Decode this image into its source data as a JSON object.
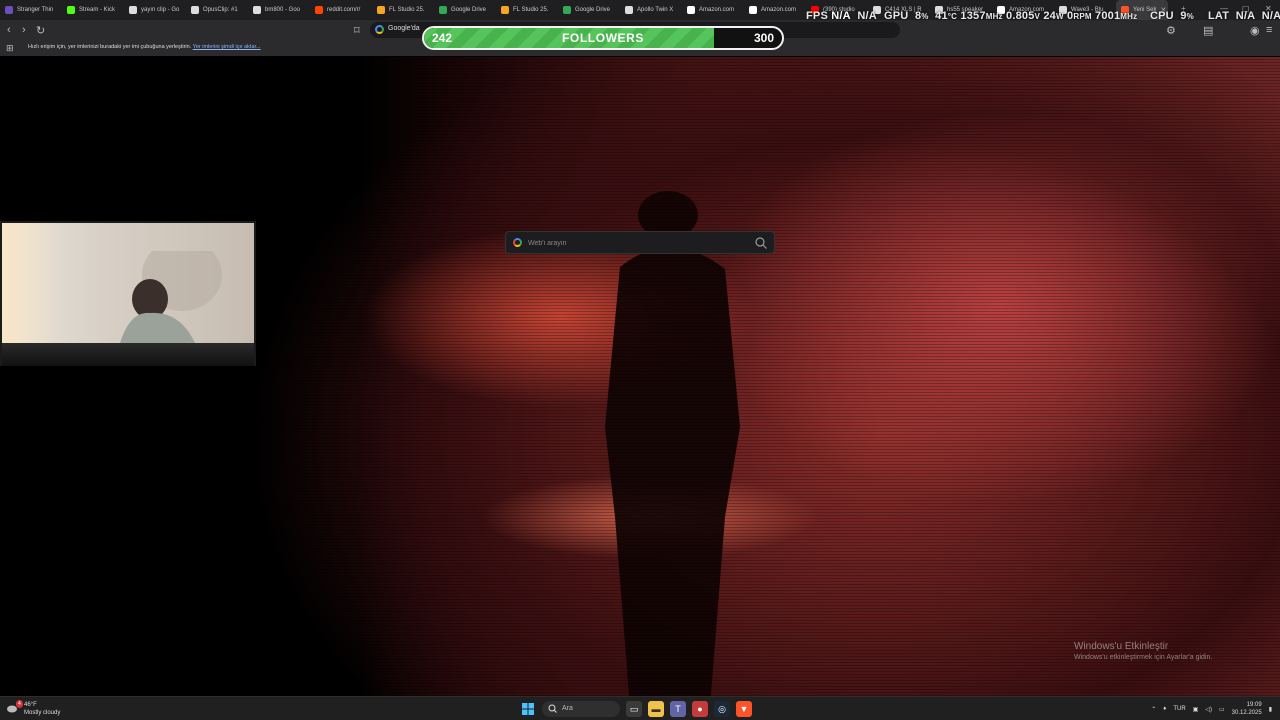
{
  "tabs": [
    {
      "label": "Stranger Thin",
      "color": "#6b4fbb"
    },
    {
      "label": "Stream - Kick",
      "color": "#53fc18"
    },
    {
      "label": "yayın clip - Go",
      "color": "#dddddd"
    },
    {
      "label": "OpusClip: #1",
      "color": "#dddddd"
    },
    {
      "label": "bm800 - Goo",
      "color": "#dddddd"
    },
    {
      "label": "reddit.com/r/",
      "color": "#ff4500"
    },
    {
      "label": "FL Studio 25.",
      "color": "#f5a623"
    },
    {
      "label": "Google Drive",
      "color": "#34a853"
    },
    {
      "label": "FL Studio 25.",
      "color": "#f5a623"
    },
    {
      "label": "Google Drive",
      "color": "#34a853"
    },
    {
      "label": "Apollo Twin X",
      "color": "#dddddd"
    },
    {
      "label": "Amazon.com",
      "color": "#ffffff"
    },
    {
      "label": "Amazon.com",
      "color": "#ffffff"
    },
    {
      "label": "(390) studio",
      "color": "#ff0000"
    },
    {
      "label": "C414 XLS | R",
      "color": "#dddddd"
    },
    {
      "label": "hs55 speaker",
      "color": "#dddddd"
    },
    {
      "label": "Amazon.com",
      "color": "#ffffff"
    },
    {
      "label": "Wave3 - Blu",
      "color": "#dddddd"
    },
    {
      "label": "Yeni Sek",
      "color": "#fb542b",
      "active": true
    }
  ],
  "stats": {
    "fps": "FPS",
    "fps_val": "N/A",
    "fps_val2": "N/A",
    "gpu": "GPU",
    "gpu_pct": "8",
    "pct": "%",
    "gpu_temp": "41",
    "temp_unit": "°C",
    "gpu_clock": "1357",
    "mhz": "MHz",
    "gpu_volt": "0.805",
    "v": "V",
    "gpu_power": "24",
    "w": "W",
    "gpu_fan": "0",
    "rpm": "RPM",
    "mem_clock": "7001",
    "mhz2": "MHz",
    "cpu": "CPU",
    "cpu_pct": "9",
    "pct2": "%",
    "lat": "LAT",
    "lat_val": "N/A",
    "lat_val2": "N/A"
  },
  "omnibox": {
    "text": "Google'da"
  },
  "bookmarks": {
    "message": "Hızlı erişim için, yer imlerinizi buradaki yer imi çubuğuna yerleştirin.",
    "import_link": "Yer imlerini şimdi içe aktar..."
  },
  "followers": {
    "current": "242",
    "label": "FOLLOWERS",
    "goal": "300",
    "progress": 0.81
  },
  "search": {
    "placeholder": "Web'i arayın"
  },
  "watermark": {
    "title": "Windows'u Etkinleştir",
    "subtitle": "Windows'u etkinleştirmek için Ayarlar'a gidin."
  },
  "taskbar": {
    "weather_badge": "4",
    "temperature": "46°F",
    "weather_desc": "Mostly cloudy",
    "search_label": "Ara",
    "lang": "TUR",
    "time": "19:09",
    "date": "30.12.2025"
  }
}
